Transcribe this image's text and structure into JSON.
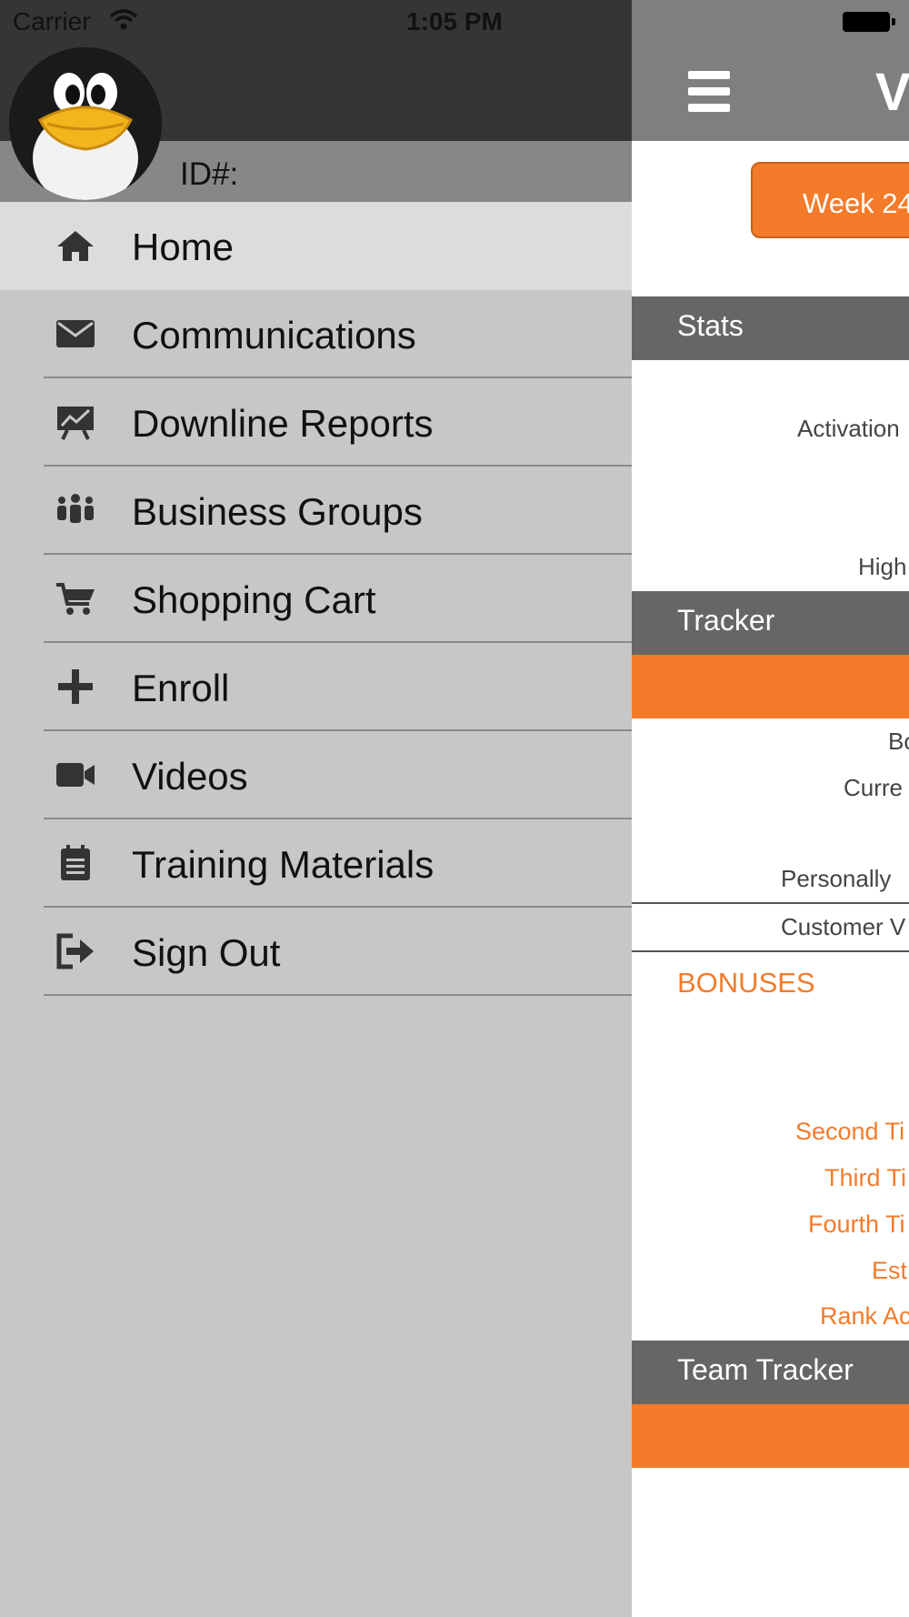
{
  "status_bar": {
    "carrier": "Carrier",
    "time": "1:05 PM"
  },
  "drawer": {
    "id_label": "ID#:",
    "menu": [
      {
        "label": "Home",
        "icon": "home-icon"
      },
      {
        "label": "Communications",
        "icon": "envelope-icon"
      },
      {
        "label": "Downline Reports",
        "icon": "presentation-chart-icon"
      },
      {
        "label": "Business Groups",
        "icon": "people-group-icon"
      },
      {
        "label": "Shopping Cart",
        "icon": "cart-icon"
      },
      {
        "label": "Enroll",
        "icon": "plus-icon"
      },
      {
        "label": "Videos",
        "icon": "video-camera-icon"
      },
      {
        "label": "Training Materials",
        "icon": "clipboard-icon"
      },
      {
        "label": "Sign Out",
        "icon": "sign-out-icon"
      }
    ],
    "active_item": "Home"
  },
  "main": {
    "title_partial": "V",
    "week_button": "Week 24",
    "stats": {
      "heading": "Stats",
      "rows": [
        "Activation",
        "High"
      ]
    },
    "tracker": {
      "heading": "Tracker",
      "rows": [
        "Bo",
        "Curre",
        "Personally",
        "Customer V"
      ]
    },
    "bonuses": {
      "heading": "BONUSES",
      "rows": [
        "Second Ti",
        "Third Ti",
        "Fourth Ti",
        "Est",
        "Rank Ac"
      ]
    },
    "team_tracker": {
      "heading": "Team Tracker"
    }
  },
  "colors": {
    "accent": "#f47b2a",
    "section": "#666666",
    "drawer": "#c7c7c7",
    "header_dark": "#353535"
  }
}
